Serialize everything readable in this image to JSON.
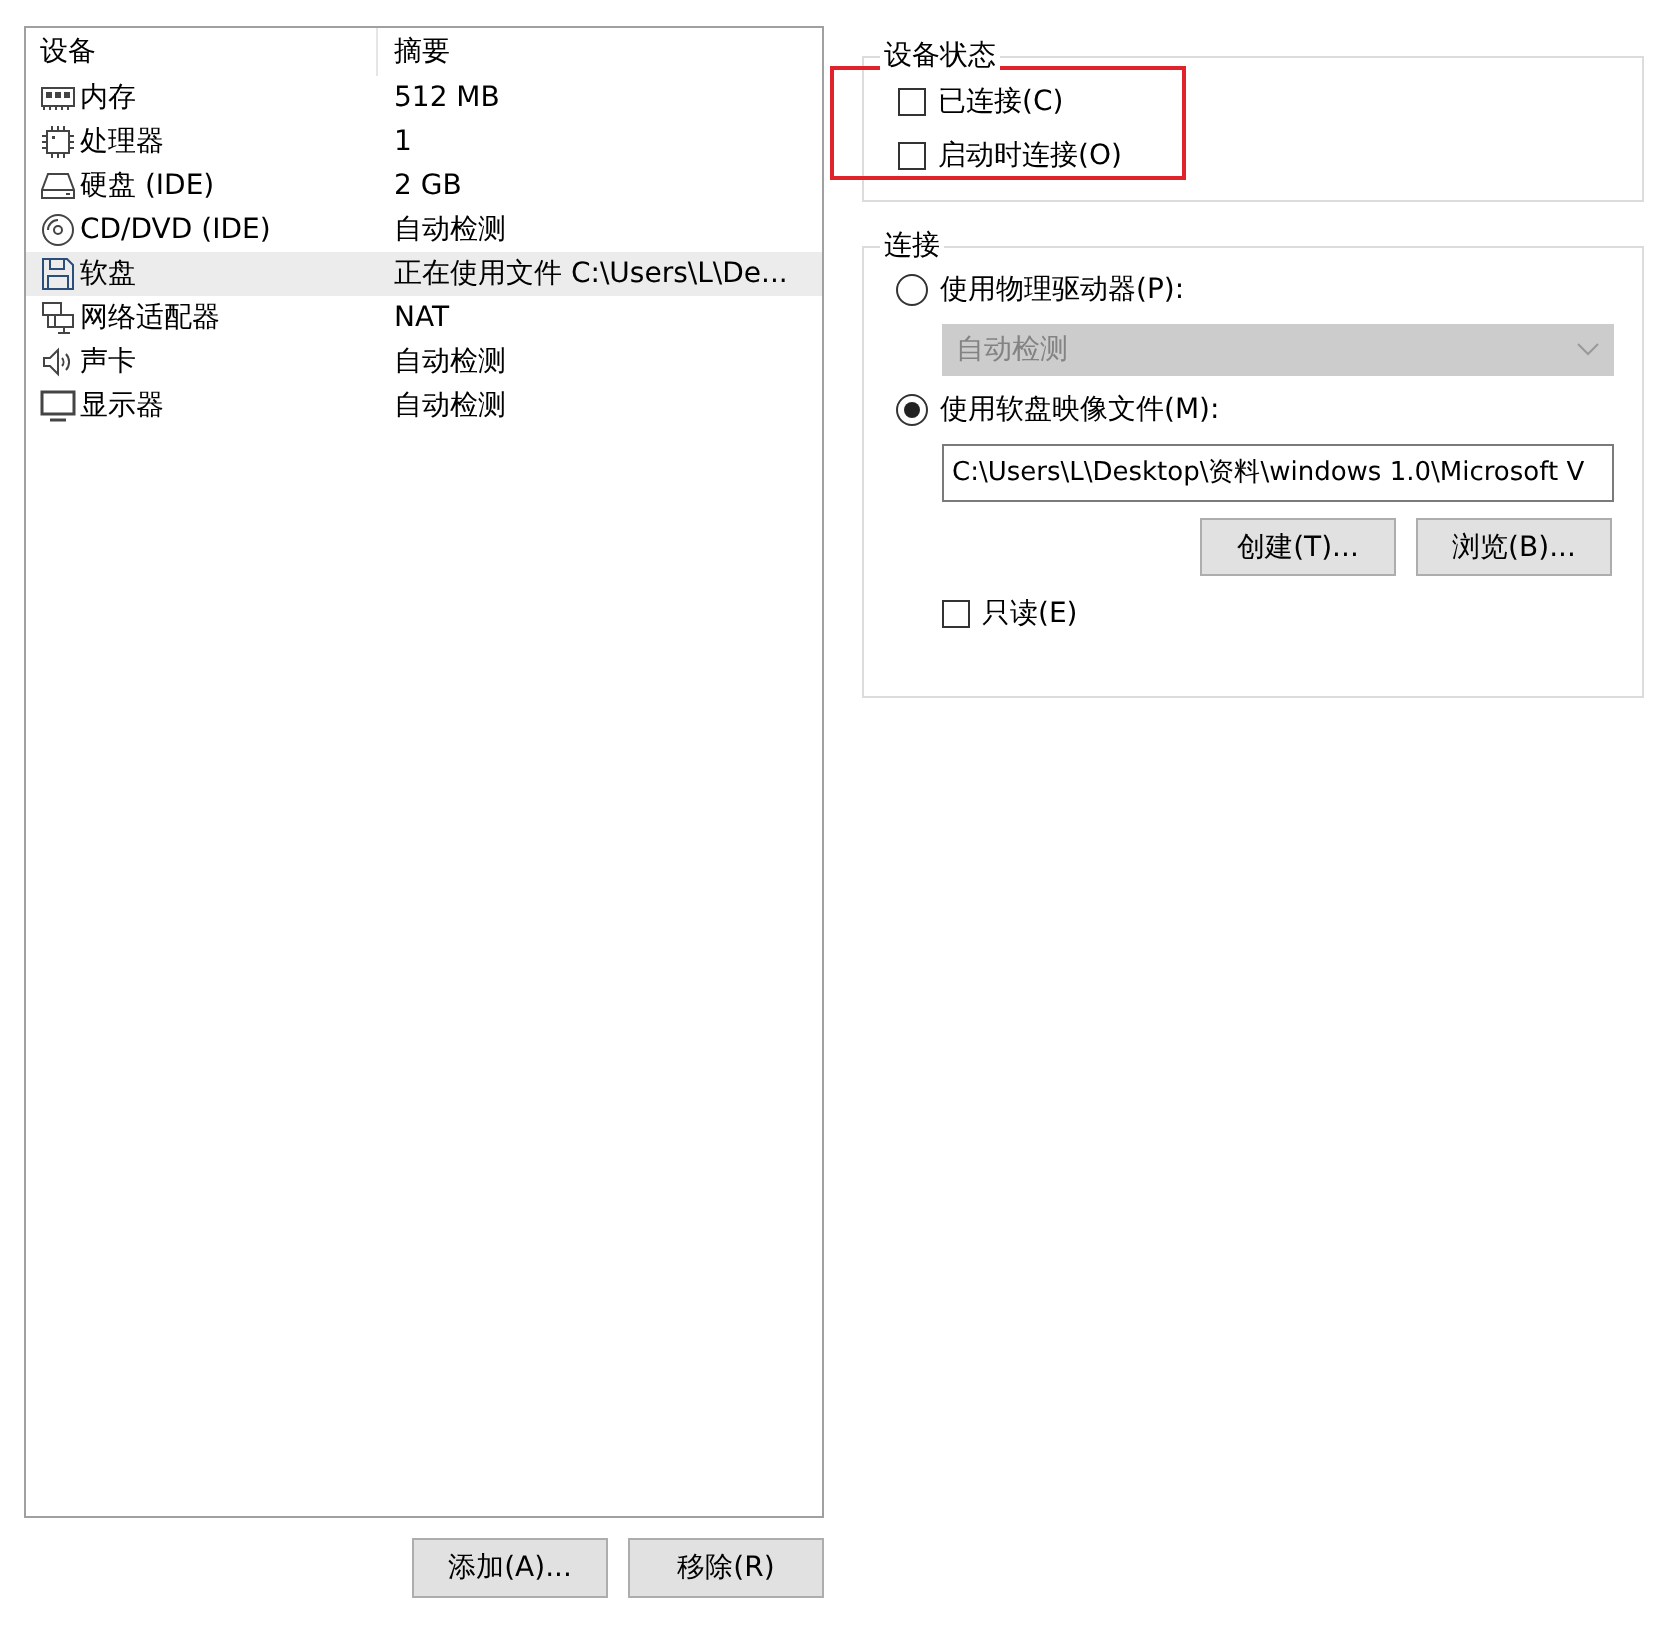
{
  "device_list": {
    "columns": [
      "设备",
      "摘要"
    ],
    "rows": [
      {
        "kind": "memory",
        "device": "内存",
        "summary": "512 MB",
        "selected": false
      },
      {
        "kind": "cpu",
        "device": "处理器",
        "summary": "1",
        "selected": false
      },
      {
        "kind": "disk",
        "device": "硬盘 (IDE)",
        "summary": "2 GB",
        "selected": false
      },
      {
        "kind": "cdrom",
        "device": "CD/DVD (IDE)",
        "summary": "自动检测",
        "selected": false
      },
      {
        "kind": "floppy",
        "device": "软盘",
        "summary": "正在使用文件 C:\\Users\\L\\De...",
        "selected": true
      },
      {
        "kind": "network",
        "device": "网络适配器",
        "summary": "NAT",
        "selected": false
      },
      {
        "kind": "sound",
        "device": "声卡",
        "summary": "自动检测",
        "selected": false
      },
      {
        "kind": "display",
        "device": "显示器",
        "summary": "自动检测",
        "selected": false
      }
    ]
  },
  "device_status": {
    "title": "设备状态",
    "highlighted": true,
    "options": [
      {
        "label": "已连接(C)",
        "checked": false
      },
      {
        "label": "启动时连接(O)",
        "checked": false
      }
    ]
  },
  "connection": {
    "title": "连接",
    "physical_drive": {
      "label": "使用物理驱动器(P):",
      "selected": false
    },
    "drive_dropdown": {
      "value": "自动检测",
      "disabled": true
    },
    "image_file": {
      "label": "使用软盘映像文件(M):",
      "selected": true
    },
    "image_path": {
      "value": "C:\\Users\\L\\Desktop\\资料\\windows 1.0\\Microsoft V"
    },
    "buttons": [
      "创建(T)...",
      "浏览(B)..."
    ],
    "read_only": {
      "label": "只读(E)",
      "checked": false
    }
  },
  "buttons": [
    "添加(A)...",
    "移除(R)"
  ]
}
